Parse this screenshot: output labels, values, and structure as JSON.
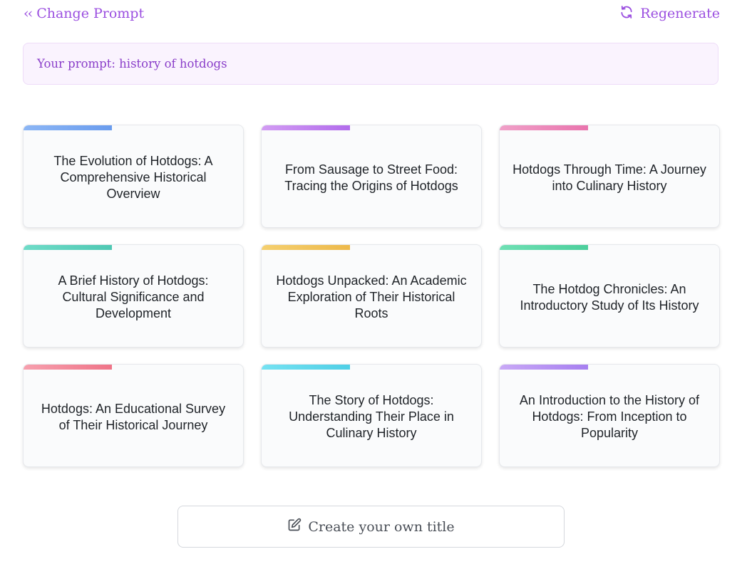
{
  "nav": {
    "back_icon": "double-chevron-left-icon",
    "back_label": "Change Prompt",
    "regenerate_icon": "refresh-icon",
    "regenerate_label": "Regenerate"
  },
  "prompt": {
    "text": "Your prompt: history of hotdogs"
  },
  "colors": {
    "accent": "#9b4fe0",
    "prompt_bg": "#faf3fe"
  },
  "titles": [
    {
      "text": "The Evolution of Hotdogs: A Comprehensive Historical Overview",
      "accent": "linear-gradient(90deg,#8cb6f5,#6a9cee)"
    },
    {
      "text": "From Sausage to Street Food: Tracing the Origins of Hotdogs",
      "accent": "linear-gradient(90deg,#d29cf3,#b26cec)"
    },
    {
      "text": "Hotdogs Through Time: A Journey into Culinary History",
      "accent": "linear-gradient(90deg,#f0a0c8,#e974ad)"
    },
    {
      "text": "A Brief History of Hotdogs: Cultural Significance and Development",
      "accent": "linear-gradient(90deg,#6fdcc8,#4fc8b3)"
    },
    {
      "text": "Hotdogs Unpacked: An Academic Exploration of Their Historical Roots",
      "accent": "linear-gradient(90deg,#f5d070,#edb94b)"
    },
    {
      "text": "The Hotdog Chronicles: An Introductory Study of Its History",
      "accent": "linear-gradient(90deg,#6fe0b4,#4ccf9c)"
    },
    {
      "text": "Hotdogs: An Educational Survey of Their Historical Journey",
      "accent": "linear-gradient(90deg,#f7a0ae,#ef7488)"
    },
    {
      "text": "The Story of Hotdogs: Understanding Their Place in Culinary History",
      "accent": "linear-gradient(90deg,#76e2f2,#4fcfe6)"
    },
    {
      "text": "An Introduction to the History of Hotdogs: From Inception to Popularity",
      "accent": "linear-gradient(90deg,#c9a9f6,#a67ff0)"
    }
  ],
  "create": {
    "icon": "edit-icon",
    "label": "Create your own title"
  }
}
